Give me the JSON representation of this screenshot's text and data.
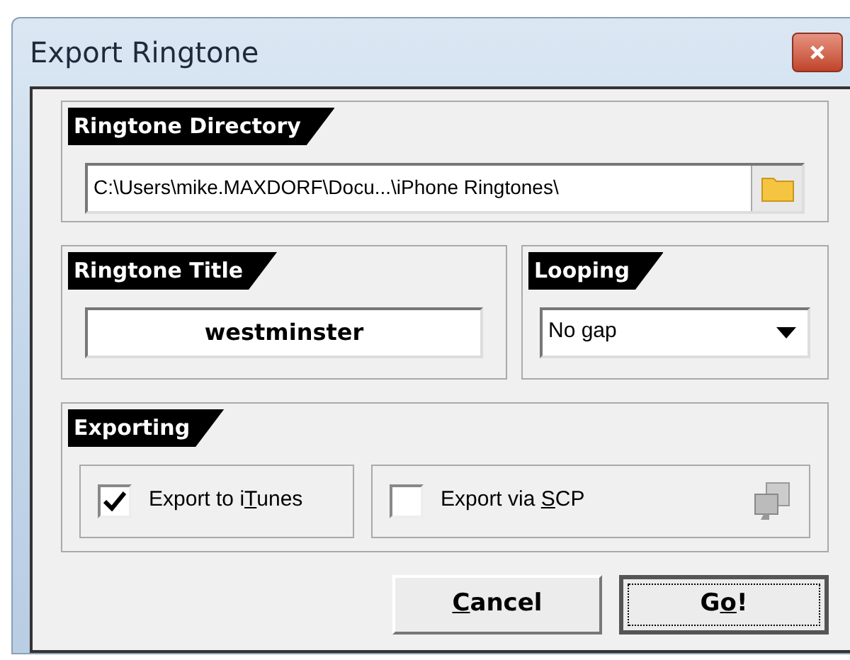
{
  "window": {
    "title": "Export Ringtone"
  },
  "directory": {
    "heading": "Ringtone Directory",
    "value": "C:\\Users\\mike.MAXDORF\\Docu...\\iPhone Ringtones\\"
  },
  "title_group": {
    "heading": "Ringtone Title",
    "value": "westminster"
  },
  "looping": {
    "heading": "Looping",
    "value": "No gap"
  },
  "exporting": {
    "heading": "Exporting",
    "options": [
      {
        "pre": "Export to i",
        "key": "T",
        "post": "unes",
        "checked": true,
        "kind": "plain"
      },
      {
        "pre": "Export via ",
        "key": "S",
        "post": "CP",
        "checked": false,
        "kind": "settings"
      }
    ]
  },
  "buttons": [
    {
      "key": "C",
      "post": "ancel",
      "default": false
    },
    {
      "pre": "G",
      "key": "o",
      "post": "!",
      "default": true
    }
  ]
}
